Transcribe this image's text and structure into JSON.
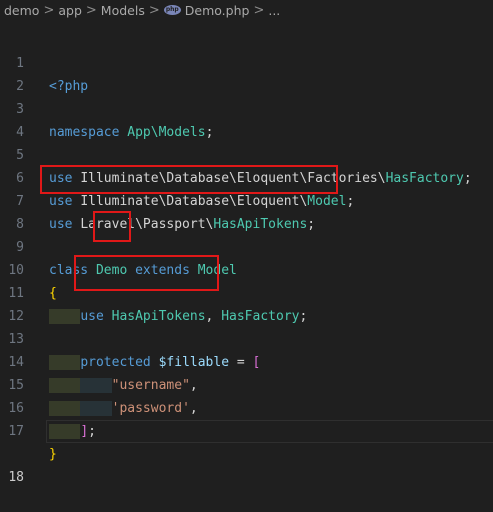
{
  "breadcrumb": {
    "items": [
      "demo",
      "app",
      "Models",
      "Demo.php",
      "..."
    ],
    "separator": ">",
    "file_icon": "php-file-icon"
  },
  "editor": {
    "language": "php",
    "current_line": 18,
    "lines": [
      {
        "n": "1"
      },
      {
        "n": "2"
      },
      {
        "n": "3"
      },
      {
        "n": "4"
      },
      {
        "n": "5"
      },
      {
        "n": "6"
      },
      {
        "n": "7"
      },
      {
        "n": "8"
      },
      {
        "n": "9"
      },
      {
        "n": "10"
      },
      {
        "n": "11"
      },
      {
        "n": "12"
      },
      {
        "n": "13"
      },
      {
        "n": "14"
      },
      {
        "n": "15"
      },
      {
        "n": "16"
      },
      {
        "n": "17"
      },
      {
        "n": "18"
      }
    ],
    "tokens": {
      "php_open": "<?php",
      "namespace_kw": "namespace",
      "namespace_name": "App\\Models",
      "semicolon": ";",
      "use_kw": "use",
      "use1_path": "Illuminate\\Database\\Eloquent\\Factories\\",
      "use1_class": "HasFactory",
      "use2_path": "Illuminate\\Database\\Eloquent\\",
      "use2_class": "Model",
      "use3_path": "Laravel\\Passport\\",
      "use3_class": "HasApiTokens",
      "class_kw": "class",
      "class_name": "Demo",
      "extends_kw": "extends",
      "parent_class": "Model",
      "open_brace": "{",
      "close_brace": "}",
      "trait1": "HasApiTokens",
      "comma": ",",
      "trait2": "HasFactory",
      "protected_kw": "protected",
      "fillable_var": "$fillable",
      "equals": "=",
      "open_bracket": "[",
      "close_bracket": "]",
      "str_username": "\"username\"",
      "str_password": "'password'"
    }
  },
  "colors": {
    "background": "#1f1f1f",
    "keyword": "#569cd6",
    "class": "#4ec9b0",
    "string": "#ce9178",
    "variable": "#9cdcfe",
    "highlight_box": "#e01818"
  }
}
